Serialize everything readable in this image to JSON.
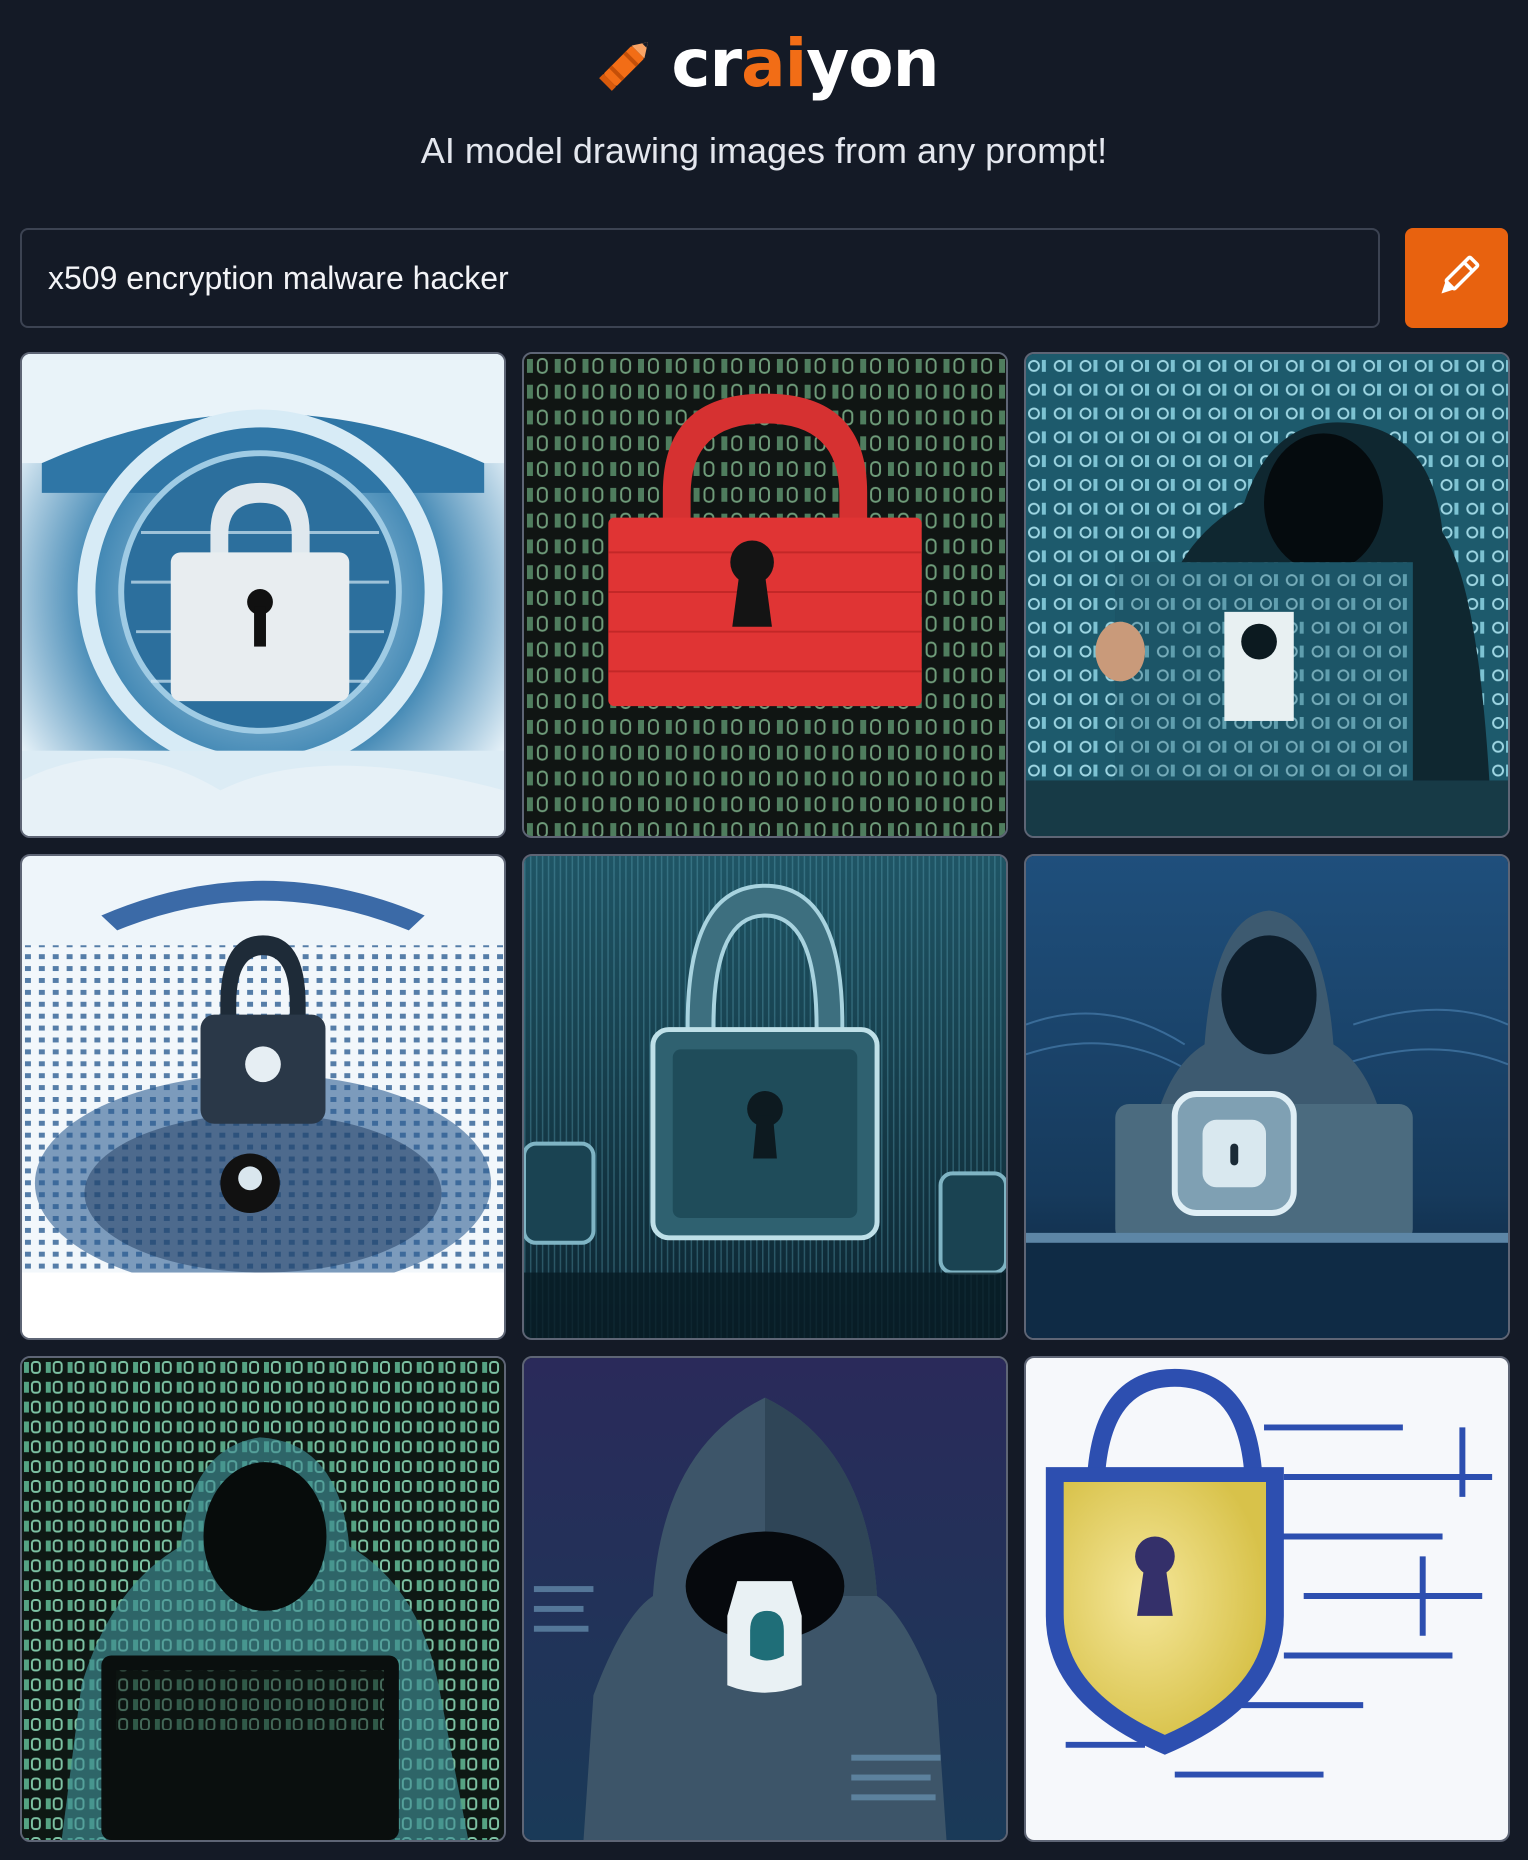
{
  "brand": {
    "name_prefix": "cr",
    "name_accent": "ai",
    "name_suffix": "yon",
    "icon": "crayon-icon",
    "accent_color": "#f26d16"
  },
  "tagline": "AI model drawing images from any prompt!",
  "prompt": {
    "value": "x509 encryption malware hacker",
    "submit_icon": "pencil-icon",
    "submit_color": "#e8620f"
  },
  "results": [
    {
      "subject": "padlock-in-circle",
      "palette": "light-blue"
    },
    {
      "subject": "red-padlock-on-binary",
      "palette": "green-red"
    },
    {
      "subject": "hooded-hacker-with-laptop",
      "palette": "teal"
    },
    {
      "subject": "padlock-over-binary-wave",
      "palette": "light-blue"
    },
    {
      "subject": "large-padlock",
      "palette": "dark-teal"
    },
    {
      "subject": "hooded-hacker-with-laptop",
      "palette": "dark-blue"
    },
    {
      "subject": "hooded-hacker-with-laptop",
      "palette": "dark-green"
    },
    {
      "subject": "hooded-figure-with-lock",
      "palette": "navy"
    },
    {
      "subject": "yellow-shield-padlock",
      "palette": "white-blue"
    }
  ]
}
